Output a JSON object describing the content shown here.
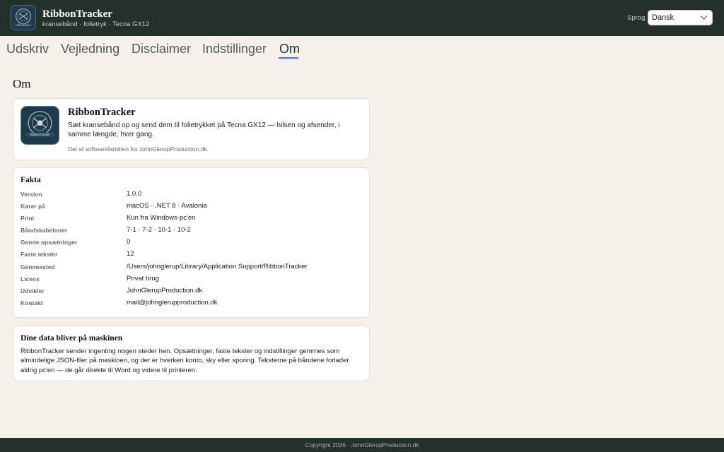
{
  "header": {
    "title": "RibbonTracker",
    "subtitle": "kransebånd · folietryk · Tecna GX12",
    "logo_text": "RibbonTracker",
    "language_label": "Sprog",
    "language_value": "Dansk"
  },
  "tabs": [
    {
      "label": "Udskriv",
      "active": false
    },
    {
      "label": "Vejledning",
      "active": false
    },
    {
      "label": "Disclaimer",
      "active": false
    },
    {
      "label": "Indstillinger",
      "active": false
    },
    {
      "label": "Om",
      "active": true
    }
  ],
  "page": {
    "title": "Om"
  },
  "about_card": {
    "title": "RibbonTracker",
    "description": "Sæt kransebånd op og send dem til folietrykket på Tecna GX12 — hilsen og afsender, i samme længde, hver gang.",
    "note": "Del af softwarefamilien fra JohnGlerupProduction.dk.",
    "logo_text": "RibbonTracker"
  },
  "facts": {
    "title": "Fakta",
    "rows": [
      {
        "label": "Version",
        "value": "1.0.0"
      },
      {
        "label": "Kører på",
        "value": "macOS · .NET 8 · Avalonia"
      },
      {
        "label": "Print",
        "value": "Kun fra Windows-pc'en"
      },
      {
        "label": "Båndskabeloner",
        "value": "7-1 · 7-2 · 10-1 · 10-2"
      },
      {
        "label": "Gemte opsætninger",
        "value": "0"
      },
      {
        "label": "Faste tekster",
        "value": "12"
      },
      {
        "label": "Gemmested",
        "value": "/Users/johnglerup/Library/Application Support/RibbonTracker"
      },
      {
        "label": "Licens",
        "value": "Privat brug"
      },
      {
        "label": "Udvikler",
        "value": "JohnGlerupProduction.dk"
      },
      {
        "label": "Kontakt",
        "value": "mail@johnglerupproduction.dk"
      }
    ]
  },
  "privacy": {
    "title": "Dine data bliver på maskinen",
    "text": "RibbonTracker sender ingenting nogen steder hen. Opsætninger, faste tekster og indstillinger gemmes som almindelige JSON-filer på maskinen, og der er hverken konto, sky eller sporing. Teksterne på båndene forlader aldrig pc'en — de går direkte til Word og videre til printeren."
  },
  "footer": {
    "text": "Copyright 2026 · JohnGlerupProduction.dk"
  },
  "colors": {
    "header_bg": "#24302a",
    "page_bg": "#f5f1ea",
    "accent": "#3b78d8"
  }
}
